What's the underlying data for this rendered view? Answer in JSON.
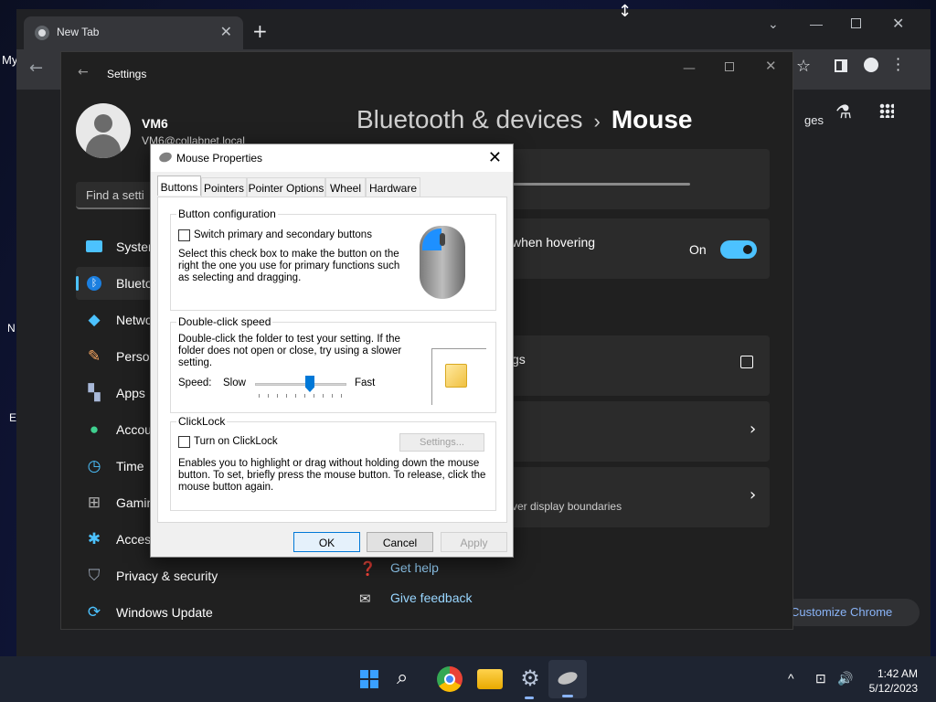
{
  "chrome": {
    "tab_title": "New Tab",
    "tab_close": "✕",
    "new_tab": "+",
    "bookmarks_left_label": "My",
    "gestures_text": "ges",
    "customize_label": "Customize Chrome",
    "left_edge_letters": [
      "N",
      "E"
    ]
  },
  "settings": {
    "title": "Settings",
    "user_name": "VM6",
    "user_email": "VM6@collabnet.local",
    "search_placeholder": "Find a setting",
    "search_visible": "Find a setti",
    "nav": [
      {
        "label": "System",
        "shown": "System",
        "icon": "monitor-icon"
      },
      {
        "label": "Bluetooth & devices",
        "shown": "Blueto",
        "icon": "bluetooth-icon"
      },
      {
        "label": "Network & internet",
        "shown": "Netwo",
        "icon": "wifi-icon"
      },
      {
        "label": "Personalization",
        "shown": "Perso",
        "icon": "brush-icon"
      },
      {
        "label": "Apps",
        "shown": "Apps",
        "icon": "apps-icon"
      },
      {
        "label": "Accounts",
        "shown": "Accou",
        "icon": "person-icon"
      },
      {
        "label": "Time & language",
        "shown": "Time",
        "icon": "clock-icon"
      },
      {
        "label": "Gaming",
        "shown": "Gamin",
        "icon": "gamepad-icon"
      },
      {
        "label": "Accessibility",
        "shown": "Acces",
        "icon": "accessibility-icon"
      },
      {
        "label": "Privacy & security",
        "shown": "Privacy & security",
        "icon": "shield-icon"
      },
      {
        "label": "Windows Update",
        "shown": "Windows Update",
        "icon": "update-icon"
      }
    ],
    "breadcrumb_parent": "Bluetooth & devices",
    "breadcrumb_sep": "›",
    "breadcrumb_current": "Mouse",
    "hover_text": "when hovering",
    "toggle_state": "On",
    "link_suffix": "gs",
    "boundaries_text": "ver display boundaries",
    "get_help": "Get help",
    "give_feedback": "Give feedback"
  },
  "dialog": {
    "title": "Mouse Properties",
    "close": "✕",
    "tabs": [
      "Buttons",
      "Pointers",
      "Pointer Options",
      "Wheel",
      "Hardware"
    ],
    "button_config": {
      "group": "Button configuration",
      "checkbox": "Switch primary and secondary buttons",
      "checked": false,
      "description": [
        "Select this check box to make the button on the",
        "right the one you use for primary functions such",
        "as selecting and dragging."
      ]
    },
    "double_click": {
      "group": "Double-click speed",
      "description": [
        "Double-click the folder to test your setting. If the",
        "folder does not open or close, try using a slower",
        "setting."
      ],
      "speed_label": "Speed:",
      "slow": "Slow",
      "fast": "Fast",
      "slider_value": 0.6
    },
    "clicklock": {
      "group": "ClickLock",
      "checkbox": "Turn on ClickLock",
      "checked": false,
      "settings_button": "Settings...",
      "description": [
        "Enables you to highlight or drag without holding down the mouse",
        "button. To set, briefly press the mouse button. To release, click the",
        "mouse button again."
      ]
    },
    "ok": "OK",
    "cancel": "Cancel",
    "apply": "Apply"
  },
  "taskbar": {
    "time": "1:42 AM",
    "date": "5/12/2023",
    "tray_chevron": "^"
  },
  "colors": {
    "accent": "#4cc2ff",
    "settings_bg": "#202020",
    "dialog_bg": "#f0f0f0",
    "taskbar_bg": "#1e2431"
  }
}
